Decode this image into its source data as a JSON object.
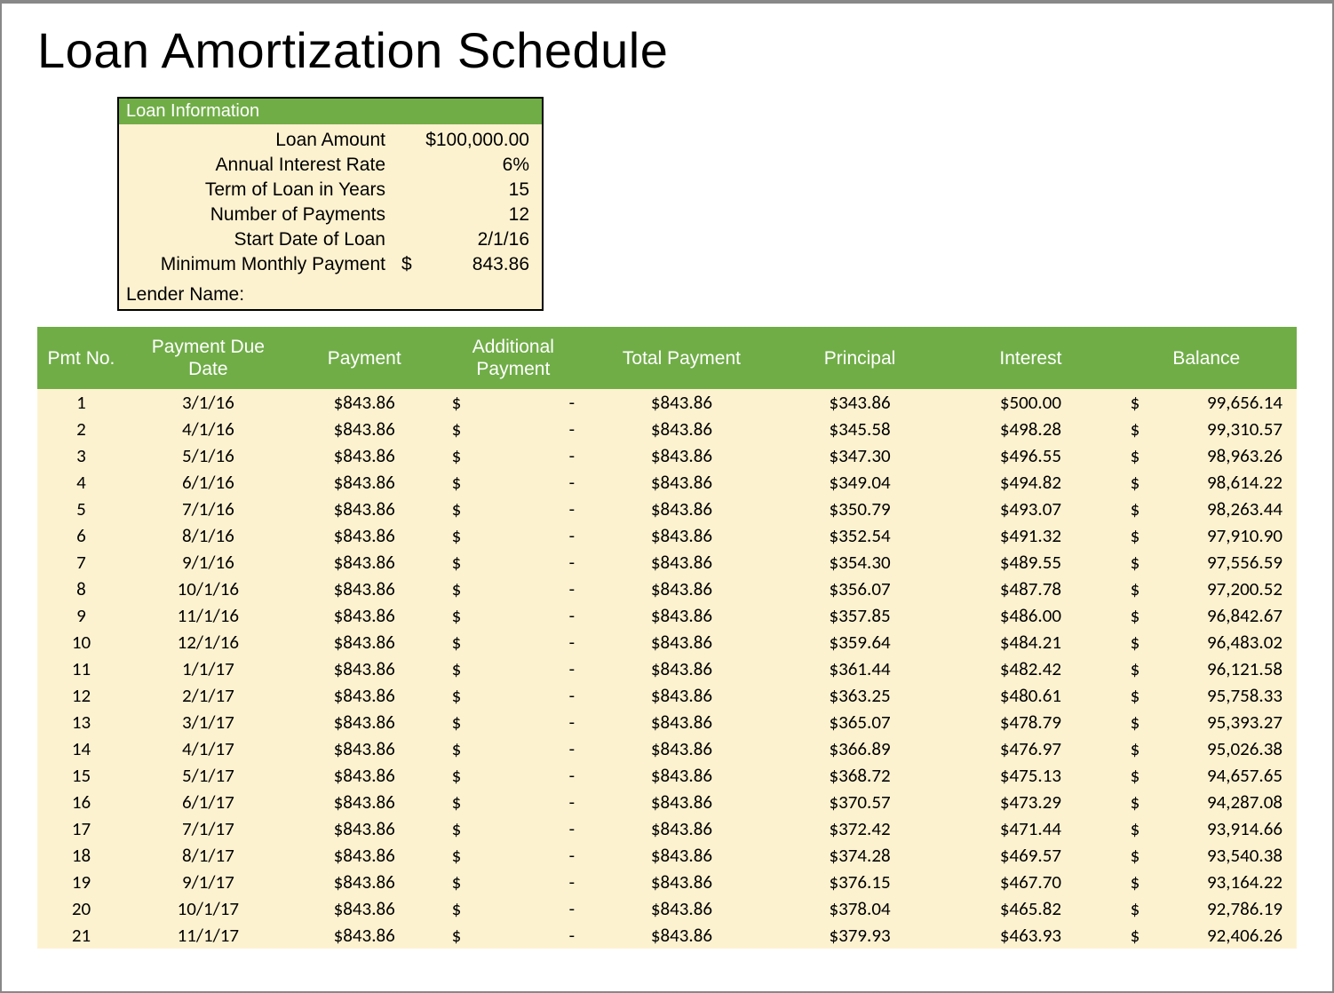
{
  "title": "Loan Amortization Schedule",
  "loan_info": {
    "header": "Loan Information",
    "rows": [
      {
        "label": "Loan Amount",
        "value": "$100,000.00"
      },
      {
        "label": "Annual Interest Rate",
        "value": "6%"
      },
      {
        "label": "Term of Loan in Years",
        "value": "15"
      },
      {
        "label": "Number of Payments",
        "value": "12"
      },
      {
        "label": "Start Date of Loan",
        "value": "2/1/16"
      },
      {
        "label": "Minimum Monthly Payment",
        "sym": "$",
        "num": "843.86"
      }
    ],
    "lender_label": "Lender Name:"
  },
  "columns": [
    "Pmt No.",
    "Payment Due Date",
    "Payment",
    "Additional Payment",
    "Total Payment",
    "Principal",
    "Interest",
    "Balance"
  ],
  "rows": [
    {
      "n": 1,
      "date": "3/1/16",
      "payment": "$843.86",
      "addl_sym": "$",
      "addl_val": "-",
      "total": "$843.86",
      "principal": "$343.86",
      "interest": "$500.00",
      "bal_sym": "$",
      "bal_val": "99,656.14"
    },
    {
      "n": 2,
      "date": "4/1/16",
      "payment": "$843.86",
      "addl_sym": "$",
      "addl_val": "-",
      "total": "$843.86",
      "principal": "$345.58",
      "interest": "$498.28",
      "bal_sym": "$",
      "bal_val": "99,310.57"
    },
    {
      "n": 3,
      "date": "5/1/16",
      "payment": "$843.86",
      "addl_sym": "$",
      "addl_val": "-",
      "total": "$843.86",
      "principal": "$347.30",
      "interest": "$496.55",
      "bal_sym": "$",
      "bal_val": "98,963.26"
    },
    {
      "n": 4,
      "date": "6/1/16",
      "payment": "$843.86",
      "addl_sym": "$",
      "addl_val": "-",
      "total": "$843.86",
      "principal": "$349.04",
      "interest": "$494.82",
      "bal_sym": "$",
      "bal_val": "98,614.22"
    },
    {
      "n": 5,
      "date": "7/1/16",
      "payment": "$843.86",
      "addl_sym": "$",
      "addl_val": "-",
      "total": "$843.86",
      "principal": "$350.79",
      "interest": "$493.07",
      "bal_sym": "$",
      "bal_val": "98,263.44"
    },
    {
      "n": 6,
      "date": "8/1/16",
      "payment": "$843.86",
      "addl_sym": "$",
      "addl_val": "-",
      "total": "$843.86",
      "principal": "$352.54",
      "interest": "$491.32",
      "bal_sym": "$",
      "bal_val": "97,910.90"
    },
    {
      "n": 7,
      "date": "9/1/16",
      "payment": "$843.86",
      "addl_sym": "$",
      "addl_val": "-",
      "total": "$843.86",
      "principal": "$354.30",
      "interest": "$489.55",
      "bal_sym": "$",
      "bal_val": "97,556.59"
    },
    {
      "n": 8,
      "date": "10/1/16",
      "payment": "$843.86",
      "addl_sym": "$",
      "addl_val": "-",
      "total": "$843.86",
      "principal": "$356.07",
      "interest": "$487.78",
      "bal_sym": "$",
      "bal_val": "97,200.52"
    },
    {
      "n": 9,
      "date": "11/1/16",
      "payment": "$843.86",
      "addl_sym": "$",
      "addl_val": "-",
      "total": "$843.86",
      "principal": "$357.85",
      "interest": "$486.00",
      "bal_sym": "$",
      "bal_val": "96,842.67"
    },
    {
      "n": 10,
      "date": "12/1/16",
      "payment": "$843.86",
      "addl_sym": "$",
      "addl_val": "-",
      "total": "$843.86",
      "principal": "$359.64",
      "interest": "$484.21",
      "bal_sym": "$",
      "bal_val": "96,483.02"
    },
    {
      "n": 11,
      "date": "1/1/17",
      "payment": "$843.86",
      "addl_sym": "$",
      "addl_val": "-",
      "total": "$843.86",
      "principal": "$361.44",
      "interest": "$482.42",
      "bal_sym": "$",
      "bal_val": "96,121.58"
    },
    {
      "n": 12,
      "date": "2/1/17",
      "payment": "$843.86",
      "addl_sym": "$",
      "addl_val": "-",
      "total": "$843.86",
      "principal": "$363.25",
      "interest": "$480.61",
      "bal_sym": "$",
      "bal_val": "95,758.33"
    },
    {
      "n": 13,
      "date": "3/1/17",
      "payment": "$843.86",
      "addl_sym": "$",
      "addl_val": "-",
      "total": "$843.86",
      "principal": "$365.07",
      "interest": "$478.79",
      "bal_sym": "$",
      "bal_val": "95,393.27"
    },
    {
      "n": 14,
      "date": "4/1/17",
      "payment": "$843.86",
      "addl_sym": "$",
      "addl_val": "-",
      "total": "$843.86",
      "principal": "$366.89",
      "interest": "$476.97",
      "bal_sym": "$",
      "bal_val": "95,026.38"
    },
    {
      "n": 15,
      "date": "5/1/17",
      "payment": "$843.86",
      "addl_sym": "$",
      "addl_val": "-",
      "total": "$843.86",
      "principal": "$368.72",
      "interest": "$475.13",
      "bal_sym": "$",
      "bal_val": "94,657.65"
    },
    {
      "n": 16,
      "date": "6/1/17",
      "payment": "$843.86",
      "addl_sym": "$",
      "addl_val": "-",
      "total": "$843.86",
      "principal": "$370.57",
      "interest": "$473.29",
      "bal_sym": "$",
      "bal_val": "94,287.08"
    },
    {
      "n": 17,
      "date": "7/1/17",
      "payment": "$843.86",
      "addl_sym": "$",
      "addl_val": "-",
      "total": "$843.86",
      "principal": "$372.42",
      "interest": "$471.44",
      "bal_sym": "$",
      "bal_val": "93,914.66"
    },
    {
      "n": 18,
      "date": "8/1/17",
      "payment": "$843.86",
      "addl_sym": "$",
      "addl_val": "-",
      "total": "$843.86",
      "principal": "$374.28",
      "interest": "$469.57",
      "bal_sym": "$",
      "bal_val": "93,540.38"
    },
    {
      "n": 19,
      "date": "9/1/17",
      "payment": "$843.86",
      "addl_sym": "$",
      "addl_val": "-",
      "total": "$843.86",
      "principal": "$376.15",
      "interest": "$467.70",
      "bal_sym": "$",
      "bal_val": "93,164.22"
    },
    {
      "n": 20,
      "date": "10/1/17",
      "payment": "$843.86",
      "addl_sym": "$",
      "addl_val": "-",
      "total": "$843.86",
      "principal": "$378.04",
      "interest": "$465.82",
      "bal_sym": "$",
      "bal_val": "92,786.19"
    },
    {
      "n": 21,
      "date": "11/1/17",
      "payment": "$843.86",
      "addl_sym": "$",
      "addl_val": "-",
      "total": "$843.86",
      "principal": "$379.93",
      "interest": "$463.93",
      "bal_sym": "$",
      "bal_val": "92,406.26"
    }
  ]
}
